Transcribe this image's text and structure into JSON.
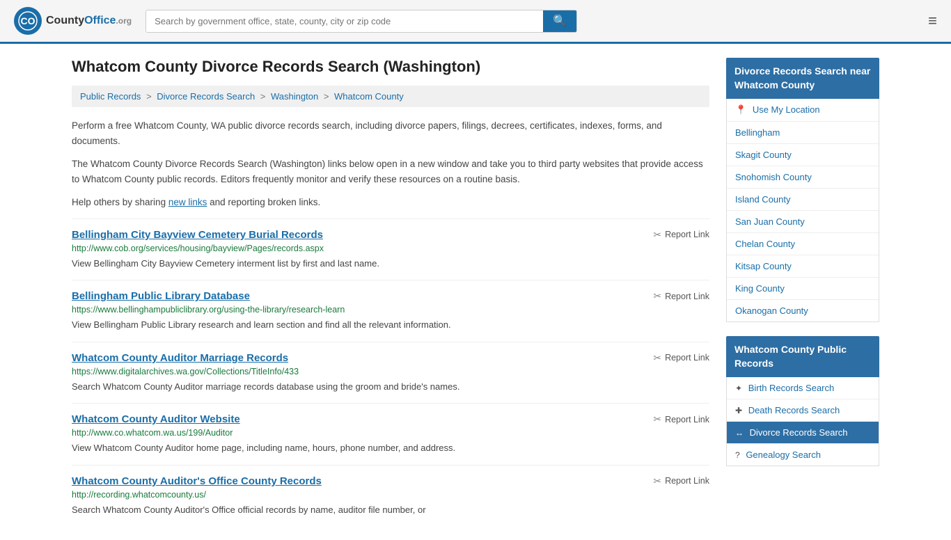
{
  "header": {
    "logo_icon": "🏛",
    "logo_name": "CountyOffice",
    "logo_org": ".org",
    "search_placeholder": "Search by government office, state, county, city or zip code",
    "search_value": ""
  },
  "page": {
    "title": "Whatcom County Divorce Records Search (Washington)",
    "breadcrumb": [
      {
        "label": "Public Records",
        "href": "#"
      },
      {
        "label": "Divorce Records Search",
        "href": "#"
      },
      {
        "label": "Washington",
        "href": "#"
      },
      {
        "label": "Whatcom County",
        "href": "#"
      }
    ],
    "description1": "Perform a free Whatcom County, WA public divorce records search, including divorce papers, filings, decrees, certificates, indexes, forms, and documents.",
    "description2": "The Whatcom County Divorce Records Search (Washington) links below open in a new window and take you to third party websites that provide access to Whatcom County public records. Editors frequently monitor and verify these resources on a routine basis.",
    "description3": "Help others by sharing",
    "new_links_text": "new links",
    "description3b": "and reporting broken links."
  },
  "results": [
    {
      "title": "Bellingham City Bayview Cemetery Burial Records",
      "url": "http://www.cob.org/services/housing/bayview/Pages/records.aspx",
      "desc": "View Bellingham City Bayview Cemetery interment list by first and last name.",
      "report": "Report Link"
    },
    {
      "title": "Bellingham Public Library Database",
      "url": "https://www.bellinghampubliclibrary.org/using-the-library/research-learn",
      "desc": "View Bellingham Public Library research and learn section and find all the relevant information.",
      "report": "Report Link"
    },
    {
      "title": "Whatcom County Auditor Marriage Records",
      "url": "https://www.digitalarchives.wa.gov/Collections/TitleInfo/433",
      "desc": "Search Whatcom County Auditor marriage records database using the groom and bride's names.",
      "report": "Report Link"
    },
    {
      "title": "Whatcom County Auditor Website",
      "url": "http://www.co.whatcom.wa.us/199/Auditor",
      "desc": "View Whatcom County Auditor home page, including name, hours, phone number, and address.",
      "report": "Report Link"
    },
    {
      "title": "Whatcom County Auditor's Office County Records",
      "url": "http://recording.whatcomcounty.us/",
      "desc": "Search Whatcom County Auditor's Office official records by name, auditor file number, or",
      "report": "Report Link"
    }
  ],
  "sidebar": {
    "nearby_header": "Divorce Records Search near Whatcom County",
    "nearby_items": [
      {
        "label": "Use My Location",
        "icon": "📍",
        "is_location": true
      },
      {
        "label": "Bellingham",
        "icon": ""
      },
      {
        "label": "Skagit County",
        "icon": ""
      },
      {
        "label": "Snohomish County",
        "icon": ""
      },
      {
        "label": "Island County",
        "icon": ""
      },
      {
        "label": "San Juan County",
        "icon": ""
      },
      {
        "label": "Chelan County",
        "icon": ""
      },
      {
        "label": "Kitsap County",
        "icon": ""
      },
      {
        "label": "King County",
        "icon": ""
      },
      {
        "label": "Okanogan County",
        "icon": ""
      }
    ],
    "public_records_header": "Whatcom County Public Records",
    "public_records_items": [
      {
        "label": "Birth Records Search",
        "icon": "✦",
        "active": false
      },
      {
        "label": "Death Records Search",
        "icon": "✚",
        "active": false
      },
      {
        "label": "Divorce Records Search",
        "icon": "↔",
        "active": true
      },
      {
        "label": "Genealogy Search",
        "icon": "?",
        "active": false
      }
    ]
  }
}
